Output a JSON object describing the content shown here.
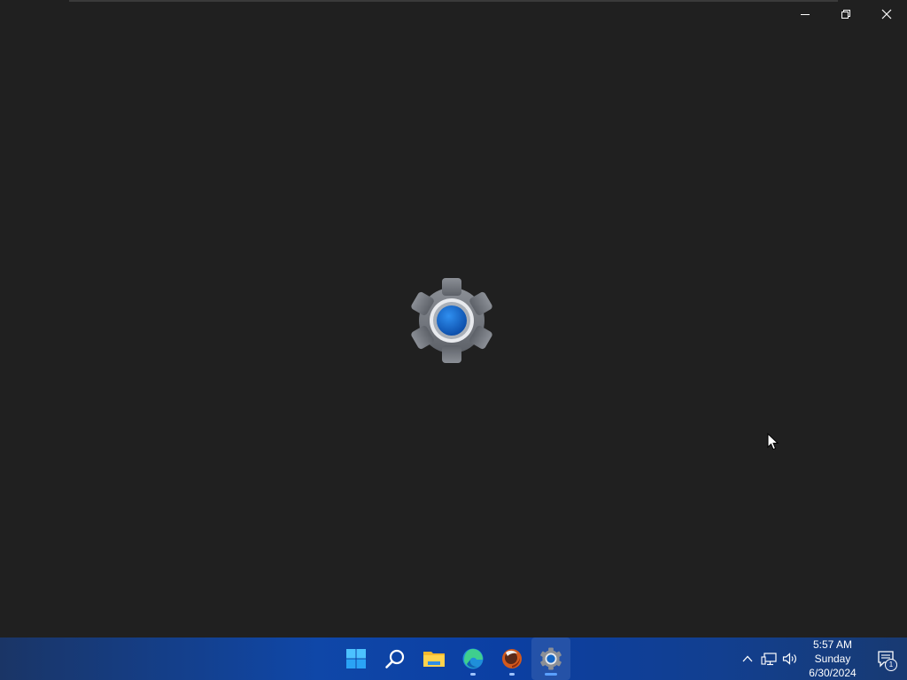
{
  "window": {
    "app": "Settings",
    "controls": {
      "minimize_icon": "minimize-icon",
      "restore_icon": "restore-icon",
      "close_icon": "close-icon"
    },
    "splash_icon": "settings-gear-icon",
    "background_color": "#202020"
  },
  "taskbar": {
    "apps": [
      {
        "name": "Start",
        "icon": "windows-start-icon",
        "running": false,
        "active": false
      },
      {
        "name": "Search",
        "icon": "search-icon",
        "running": false,
        "active": false
      },
      {
        "name": "File Explorer",
        "icon": "folder-icon",
        "running": false,
        "active": false
      },
      {
        "name": "Microsoft Edge",
        "icon": "edge-icon",
        "running": true,
        "active": false
      },
      {
        "name": "Browser",
        "icon": "globe-browser-icon",
        "running": true,
        "active": false
      },
      {
        "name": "Settings",
        "icon": "settings-gear-icon",
        "running": true,
        "active": true
      }
    ],
    "tray": {
      "icons": [
        "chevron-up-icon",
        "network-icon",
        "volume-icon"
      ]
    },
    "clock": {
      "time": "5:57 AM",
      "day": "Sunday",
      "date": "6/30/2024"
    },
    "notifications": {
      "icon": "notification-icon",
      "count": "1"
    }
  },
  "colors": {
    "taskbar_blue": "#0f47a8",
    "accent": "#5aa0ff"
  }
}
